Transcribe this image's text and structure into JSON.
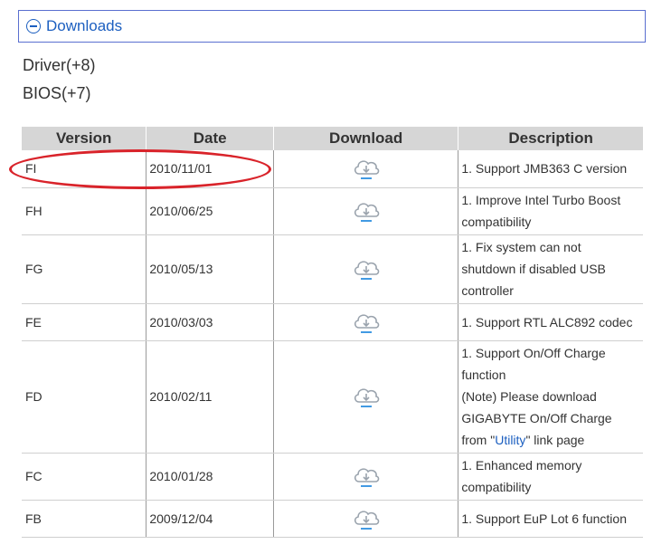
{
  "section": {
    "title": "Downloads"
  },
  "categories": {
    "driver": "Driver(+8)",
    "bios": "BIOS(+7)"
  },
  "table": {
    "headers": [
      "Version",
      "Date",
      "Download",
      "Description"
    ],
    "rows": [
      {
        "version": "FI",
        "date": "2010/11/01",
        "desc": [
          "1. Support JMB363 C version"
        ]
      },
      {
        "version": "FH",
        "date": "2010/06/25",
        "desc": [
          "1. Improve Intel Turbo Boost",
          "compatibility"
        ]
      },
      {
        "version": "FG",
        "date": "2010/05/13",
        "desc": [
          "1. Fix system can not",
          "shutdown if disabled USB",
          "controller"
        ]
      },
      {
        "version": "FE",
        "date": "2010/03/03",
        "desc": [
          "1. Support RTL ALC892 codec"
        ]
      },
      {
        "version": "FD",
        "date": "2010/02/11",
        "desc": [
          "1. Support On/Off Charge",
          "function",
          "(Note) Please download",
          "GIGABYTE On/Off Charge"
        ],
        "desc_link": {
          "before": "from \"",
          "link": "Utility",
          "after": "\" link page"
        }
      },
      {
        "version": "FC",
        "date": "2010/01/28",
        "desc": [
          "1. Enhanced memory",
          "compatibility"
        ]
      },
      {
        "version": "FB",
        "date": "2009/12/04",
        "desc": [
          "1. Support EuP Lot 6 function"
        ]
      }
    ]
  },
  "colors": {
    "link": "#1c5fc0",
    "header_bg": "#d6d6d6",
    "highlight": "#d9232a"
  }
}
